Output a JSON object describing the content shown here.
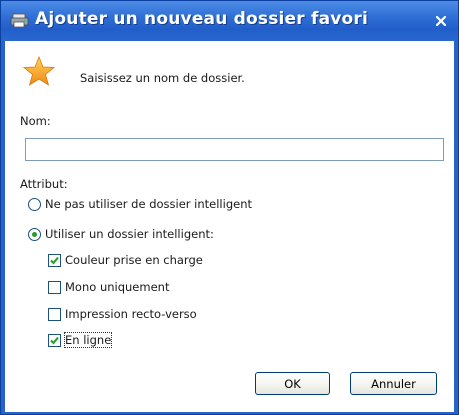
{
  "window": {
    "title": "Ajouter un nouveau dossier favori",
    "close_glyph": "×",
    "title_bar_color": "#2863c6"
  },
  "prompt": {
    "icon": "star-icon",
    "text": "Saisissez un nom de dossier."
  },
  "name_field": {
    "label": "Nom:",
    "value": "",
    "placeholder": ""
  },
  "attribute": {
    "label": "Attribut:",
    "radios": [
      {
        "label": "Ne pas utiliser de dossier intelligent",
        "selected": false
      },
      {
        "label": "Utiliser un dossier intelligent:",
        "selected": true
      }
    ],
    "checkboxes": [
      {
        "label": "Couleur prise en charge",
        "checked": true
      },
      {
        "label": "Mono uniquement",
        "checked": false
      },
      {
        "label": "Impression recto-verso",
        "checked": false
      },
      {
        "label": "En ligne",
        "checked": true,
        "focused": true
      }
    ]
  },
  "buttons": {
    "ok_label": "OK",
    "cancel_label": "Annuler"
  }
}
